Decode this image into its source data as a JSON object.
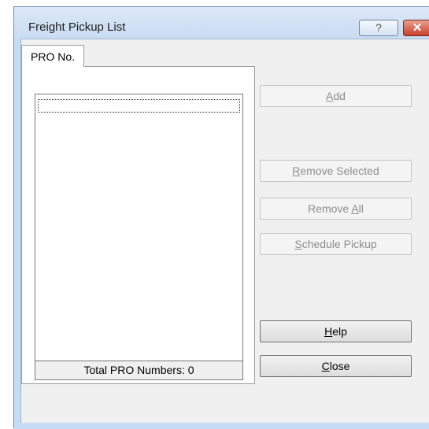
{
  "window": {
    "title": "Freight Pickup List",
    "help_button_glyph": "?",
    "close_button_glyph": "✕"
  },
  "tabs": [
    {
      "label": "PRO No."
    }
  ],
  "list": {
    "items": [],
    "total_label": "Total PRO Numbers: 0"
  },
  "buttons": {
    "add": {
      "label": "Add",
      "mnemonic": "A",
      "enabled": false
    },
    "remove_selected": {
      "label": "Remove Selected",
      "mnemonic": "R",
      "enabled": false
    },
    "remove_all": {
      "label": "Remove All",
      "mnemonic": "A",
      "enabled": false
    },
    "schedule_pickup": {
      "label": "Schedule Pickup",
      "mnemonic": "S",
      "enabled": false
    },
    "help": {
      "label": "Help",
      "mnemonic": "H",
      "enabled": true
    },
    "close": {
      "label": "Close",
      "mnemonic": "C",
      "enabled": true
    }
  },
  "icons": {
    "titlebar_help": "question-mark-icon",
    "titlebar_close": "close-x-icon"
  }
}
